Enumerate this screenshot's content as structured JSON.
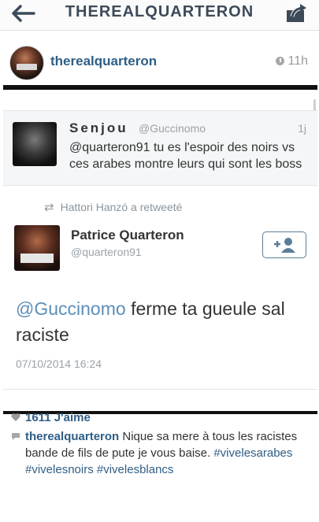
{
  "header": {
    "title": "THEREALQUARTERON"
  },
  "post": {
    "username": "therealquarteron",
    "time": "11h"
  },
  "quoted_tweet": {
    "name": "Senjou",
    "handle": "@Guccinomo",
    "time": "1j",
    "text": "@quarteron91 tu es l'espoir des noirs vs ces arabes montre leurs qui sont les boss"
  },
  "retweet": {
    "label": "Hattori Hanzó a retweeté"
  },
  "tweet": {
    "name": "Patrice Quarteron",
    "handle": "@quarteron91",
    "mention": "@Guccinomo",
    "text": " ferme ta gueule sal raciste",
    "date": "07/10/2014 16:24"
  },
  "footer": {
    "likes": "1611 J'aime",
    "comment_user": "therealquarteron",
    "comment_text": " Nique sa mere à tous les racistes bande de fils de pute je vous baise. ",
    "hashtags": "#vivelesarabes #vivelesnoirs #vivelesblancs"
  }
}
